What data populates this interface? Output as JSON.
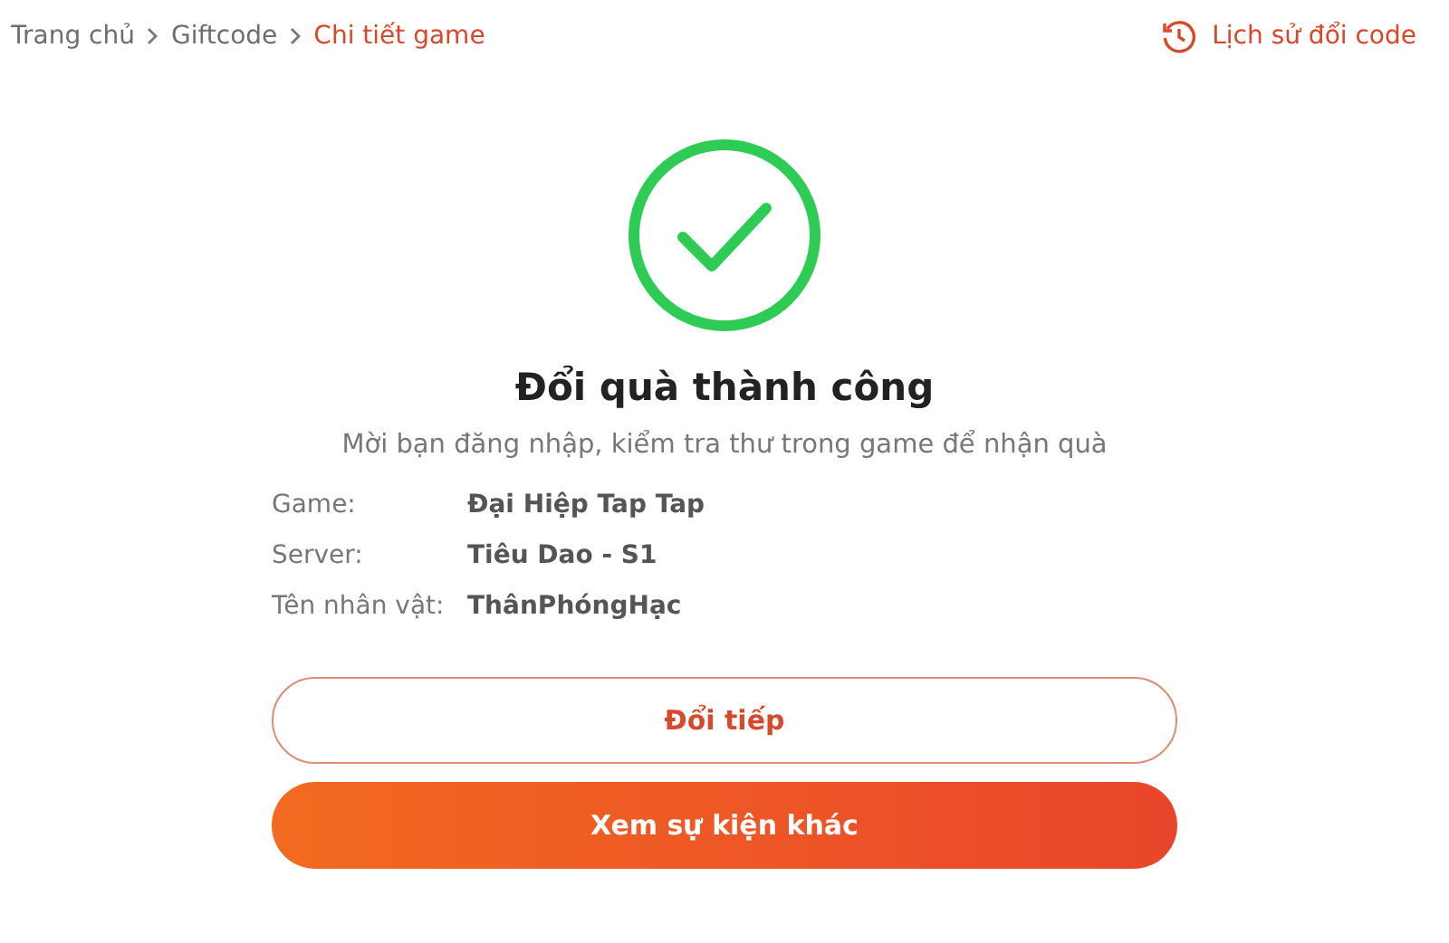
{
  "breadcrumb": [
    {
      "label": "Trang chủ",
      "selected": false
    },
    {
      "label": "Giftcode",
      "selected": false
    },
    {
      "label": "Chi tiết game",
      "selected": true
    }
  ],
  "history_link": "Lịch sử đổi code",
  "title": "Đổi quà thành công",
  "subtitle": "Mời bạn đăng nhập, kiểm tra thư trong game để nhận quà",
  "details": [
    {
      "label": "Game:",
      "value": "Đại Hiệp Tap Tap"
    },
    {
      "label": "Server:",
      "value": "Tiêu Dao - S1"
    },
    {
      "label": "Tên nhân vật:",
      "value": "ThânPhóngHạc"
    }
  ],
  "buttons": [
    {
      "label": "Đổi tiếp",
      "kind": "outline"
    },
    {
      "label": "Xem sự kiện khác",
      "kind": "filled"
    }
  ]
}
